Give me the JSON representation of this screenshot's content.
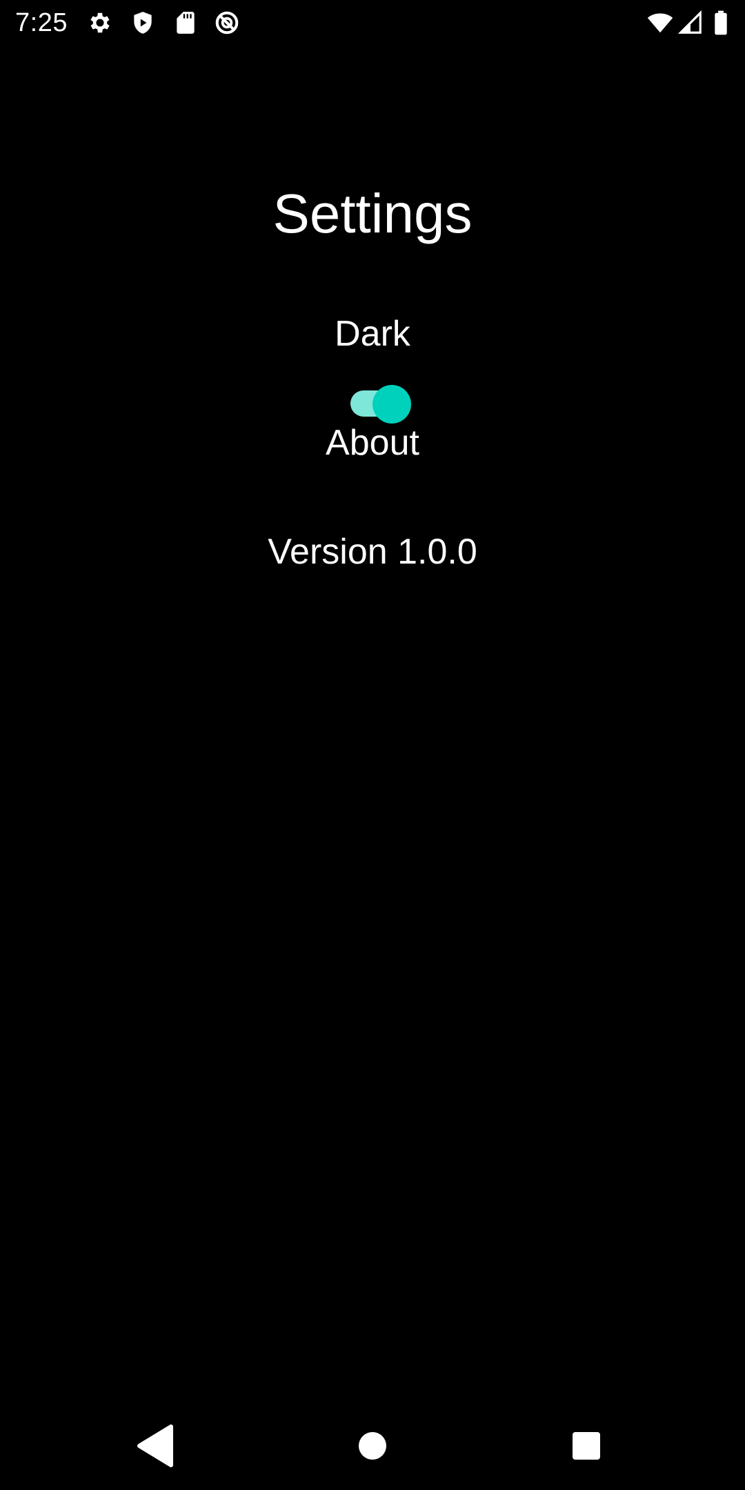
{
  "status_bar": {
    "time": "7:25",
    "left_icons": [
      "settings-icon",
      "play-protect-icon",
      "sd-card-icon",
      "vpn-icon"
    ],
    "right_icons": [
      "wifi-icon",
      "cell-signal-icon",
      "battery-icon"
    ]
  },
  "settings": {
    "title": "Settings",
    "theme_label": "Dark",
    "theme_toggle_on": true,
    "about_label": "About",
    "version_text": "Version 1.0.0"
  },
  "nav_bar": {
    "buttons": [
      "back-icon",
      "home-icon",
      "recents-icon"
    ]
  },
  "colors": {
    "background": "#000000",
    "text": "#ffffff",
    "toggle_track": "#7fe6da",
    "toggle_thumb": "#00d1bc"
  }
}
